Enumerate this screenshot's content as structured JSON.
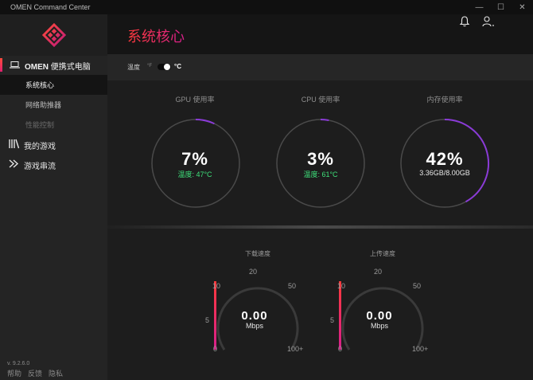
{
  "window": {
    "title": "OMEN Command Center",
    "controls": {
      "minimize": "—",
      "maximize": "☐",
      "close": "✕"
    }
  },
  "sidebar": {
    "device_label_bold": "OMEN",
    "device_label_rest": " 便携式电脑",
    "subitems": [
      {
        "label": "系统核心",
        "state": "active"
      },
      {
        "label": "网络助推器",
        "state": "normal"
      },
      {
        "label": "性能控制",
        "state": "disabled"
      }
    ],
    "items": [
      {
        "label": "我的游戏",
        "icon": "library-icon"
      },
      {
        "label": "游戏串流",
        "icon": "stream-icon"
      }
    ],
    "version": "v. 9.2.6.0",
    "footer": [
      "帮助",
      "反馈",
      "隐私"
    ]
  },
  "header": {
    "page_title": "系统核心",
    "icons": [
      "bell-icon",
      "user-icon"
    ]
  },
  "temperature": {
    "label": "温度",
    "unit_f": "°F",
    "unit_c": "°C",
    "selected": "°C"
  },
  "gauges": [
    {
      "title": "GPU 使用率",
      "value": "7%",
      "percent": 7,
      "sub": "温度: 47°C",
      "sub_color": "green"
    },
    {
      "title": "CPU 使用率",
      "value": "3%",
      "percent": 3,
      "sub": "温度: 61°C",
      "sub_color": "green"
    },
    {
      "title": "内存使用率",
      "value": "42%",
      "percent": 42,
      "sub": "3.36GB/8.00GB",
      "sub_color": "white"
    }
  ],
  "speeds": [
    {
      "title": "下载速度",
      "value": "0.00",
      "unit": "Mbps",
      "ticks": [
        "0",
        "5",
        "10",
        "20",
        "50",
        "100+"
      ]
    },
    {
      "title": "上传速度",
      "value": "0.00",
      "unit": "Mbps",
      "ticks": [
        "0",
        "5",
        "10",
        "20",
        "50",
        "100+"
      ]
    }
  ],
  "colors": {
    "accent_red": "#ff3a3a",
    "accent_pink": "#d71f8c",
    "accent_purple": "#8a3bd6",
    "temp_green": "#3ee07a"
  }
}
